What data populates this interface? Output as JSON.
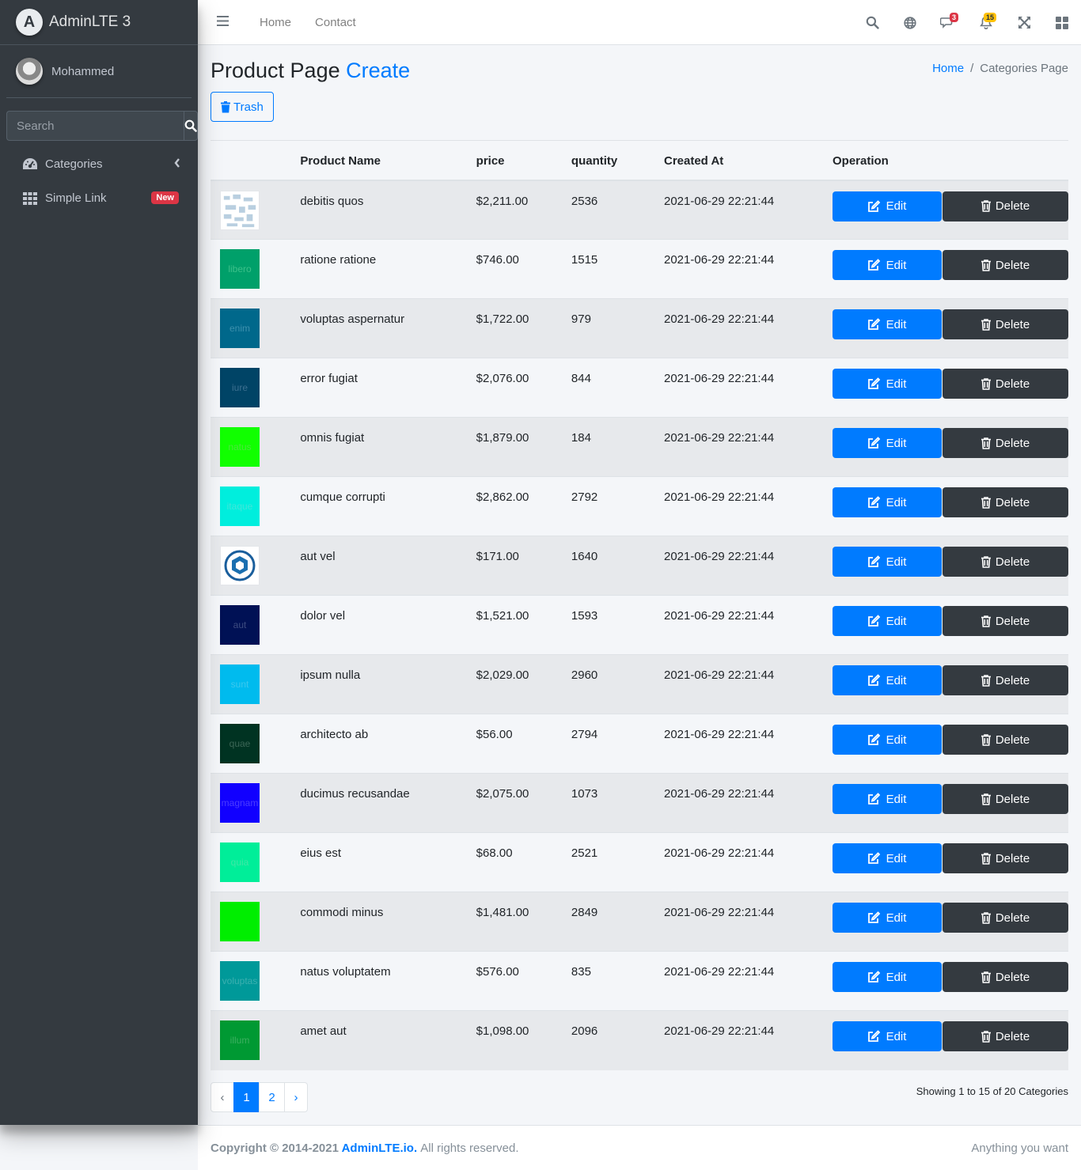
{
  "brand": {
    "logo_letter": "A",
    "name": "AdminLTE 3"
  },
  "user": {
    "name": "Mohammed"
  },
  "sidebar": {
    "search_placeholder": "Search",
    "items": [
      {
        "label": "Categories",
        "icon": "tachometer-icon"
      },
      {
        "label": "Simple Link",
        "icon": "th-icon",
        "badge": "New"
      }
    ]
  },
  "topbar": {
    "links": [
      "Home",
      "Contact"
    ],
    "messages_badge": "3",
    "notifications_badge": "15"
  },
  "page": {
    "title": "Product Page",
    "create_label": "Create",
    "breadcrumb": [
      "Home",
      "Categories Page"
    ],
    "trash_label": "Trash"
  },
  "table": {
    "headers": [
      "",
      "Product Name",
      "price",
      "quantity",
      "Created At",
      "Operation"
    ],
    "edit_label": "Edit",
    "delete_label": "Delete",
    "rows": [
      {
        "name": "debitis quos",
        "price": "$2,211.00",
        "qty": "2536",
        "created": "2021-06-29 22:21:44",
        "thumb_color": "#ffffff",
        "thumb_text": "",
        "thumb_text_color": "#9bb"
      },
      {
        "name": "ratione ratione",
        "price": "$746.00",
        "qty": "1515",
        "created": "2021-06-29 22:21:44",
        "thumb_color": "#00a06a",
        "thumb_text": "libero",
        "thumb_text_color": "#3cc08a"
      },
      {
        "name": "voluptas aspernatur",
        "price": "$1,722.00",
        "qty": "979",
        "created": "2021-06-29 22:21:44",
        "thumb_color": "#00688b",
        "thumb_text": "enim",
        "thumb_text_color": "#3d90ad"
      },
      {
        "name": "error fugiat",
        "price": "$2,076.00",
        "qty": "844",
        "created": "2021-06-29 22:21:44",
        "thumb_color": "#004466",
        "thumb_text": "iure",
        "thumb_text_color": "#3c7090"
      },
      {
        "name": "omnis fugiat",
        "price": "$1,879.00",
        "qty": "184",
        "created": "2021-06-29 22:21:44",
        "thumb_color": "#11ff00",
        "thumb_text": "natus",
        "thumb_text_color": "#4be63c"
      },
      {
        "name": "cumque corrupti",
        "price": "$2,862.00",
        "qty": "2792",
        "created": "2021-06-29 22:21:44",
        "thumb_color": "#00eedd",
        "thumb_text": "itaque",
        "thumb_text_color": "#40e6da"
      },
      {
        "name": "aut vel",
        "price": "$171.00",
        "qty": "1640",
        "created": "2021-06-29 22:21:44",
        "thumb_color": "#ffffff",
        "thumb_text": "",
        "thumb_text_color": "#1a6fb0"
      },
      {
        "name": "dolor vel",
        "price": "$1,521.00",
        "qty": "1593",
        "created": "2021-06-29 22:21:44",
        "thumb_color": "#001155",
        "thumb_text": "aut",
        "thumb_text_color": "#3c4c80"
      },
      {
        "name": "ipsum nulla",
        "price": "$2,029.00",
        "qty": "2960",
        "created": "2021-06-29 22:21:44",
        "thumb_color": "#00bbee",
        "thumb_text": "sunt",
        "thumb_text_color": "#3cc8ee"
      },
      {
        "name": "architecto ab",
        "price": "$56.00",
        "qty": "2794",
        "created": "2021-06-29 22:21:44",
        "thumb_color": "#003322",
        "thumb_text": "quae",
        "thumb_text_color": "#3c6656"
      },
      {
        "name": "ducimus recusandae",
        "price": "$2,075.00",
        "qty": "1073",
        "created": "2021-06-29 22:21:44",
        "thumb_color": "#1100ff",
        "thumb_text": "magnam",
        "thumb_text_color": "#4b3cff"
      },
      {
        "name": "eius est",
        "price": "$68.00",
        "qty": "2521",
        "created": "2021-06-29 22:21:44",
        "thumb_color": "#00ee99",
        "thumb_text": "quia",
        "thumb_text_color": "#40e6a6"
      },
      {
        "name": "commodi minus",
        "price": "$1,481.00",
        "qty": "2849",
        "created": "2021-06-29 22:21:44",
        "thumb_color": "#00ee00",
        "thumb_text": "",
        "thumb_text_color": "#3cd23c"
      },
      {
        "name": "natus voluptatem",
        "price": "$576.00",
        "qty": "835",
        "created": "2021-06-29 22:21:44",
        "thumb_color": "#009999",
        "thumb_text": "voluptas",
        "thumb_text_color": "#3cb0b0"
      },
      {
        "name": "amet aut",
        "price": "$1,098.00",
        "qty": "2096",
        "created": "2021-06-29 22:21:44",
        "thumb_color": "#009933",
        "thumb_text": "illum",
        "thumb_text_color": "#3cb060"
      }
    ]
  },
  "pagination": {
    "prev": "‹",
    "pages": [
      "1",
      "2"
    ],
    "active": "1",
    "next": "›"
  },
  "showing_text": "Showing 1 to 15 of 20 Categories",
  "footer": {
    "copyright": "Copyright © 2014-2021",
    "brand_link": "AdminLTE.io.",
    "rights": "All rights reserved.",
    "right_text": "Anything you want"
  },
  "colors": {
    "primary": "#007bff",
    "dark": "#343a40",
    "danger": "#dc3545",
    "warning": "#ffc107"
  }
}
